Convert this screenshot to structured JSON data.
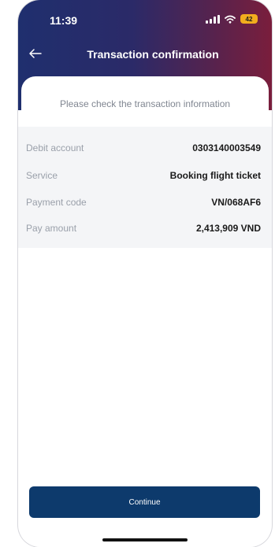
{
  "status_bar": {
    "time": "11:39",
    "battery": "42",
    "battery_color": "#f2ad1e"
  },
  "header": {
    "back_icon": "arrow-left-icon",
    "title": "Transaction confirmation",
    "gradient_colors": [
      "#1f2f6e",
      "#2b2a68",
      "#54234f",
      "#7a1e3c"
    ]
  },
  "main": {
    "instruction": "Please check the transaction information",
    "details": [
      {
        "label": "Debit account",
        "value": "0303140003549"
      },
      {
        "label": "Service",
        "value": "Booking flight ticket"
      },
      {
        "label": "Payment code",
        "value": "VN/068AF6"
      },
      {
        "label": "Pay amount",
        "value": "2,413,909 VND"
      }
    ]
  },
  "footer": {
    "continue_label": "Continue",
    "button_color": "#0d3a6c"
  }
}
